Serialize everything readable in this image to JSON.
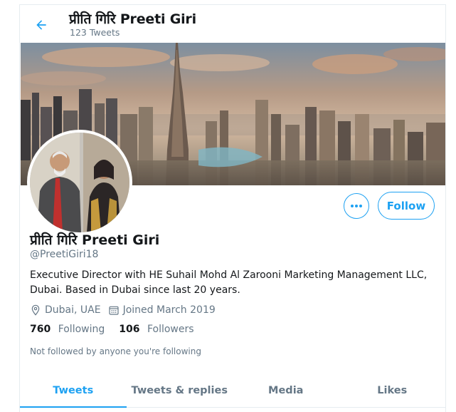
{
  "header": {
    "title": "प्रीति गिरि Preeti Giri",
    "tweet_count": "123 Tweets"
  },
  "profile": {
    "display_name": "प्रीति गिरि Preeti Giri",
    "handle": "@PreetiGiri18",
    "bio": "Executive Director with HE Suhail Mohd  Al Zarooni Marketing  Management LLC, Dubai. Based in Dubai since last 20 years.",
    "location": "Dubai, UAE",
    "joined": "Joined March 2019",
    "following_count": "760",
    "following_label": "Following",
    "followers_count": "106",
    "followers_label": "Followers",
    "follow_notice": "Not followed by anyone you're following"
  },
  "actions": {
    "follow_label": "Follow"
  },
  "tabs": [
    {
      "label": "Tweets",
      "active": true
    },
    {
      "label": "Tweets & replies",
      "active": false
    },
    {
      "label": "Media",
      "active": false
    },
    {
      "label": "Likes",
      "active": false
    }
  ],
  "icons": {
    "back": "arrow-left-icon",
    "more": "more-dots-icon",
    "location": "location-pin-icon",
    "calendar": "calendar-icon"
  },
  "colors": {
    "accent": "#1da1f2",
    "secondary_text": "#657786",
    "primary_text": "#14171a"
  }
}
